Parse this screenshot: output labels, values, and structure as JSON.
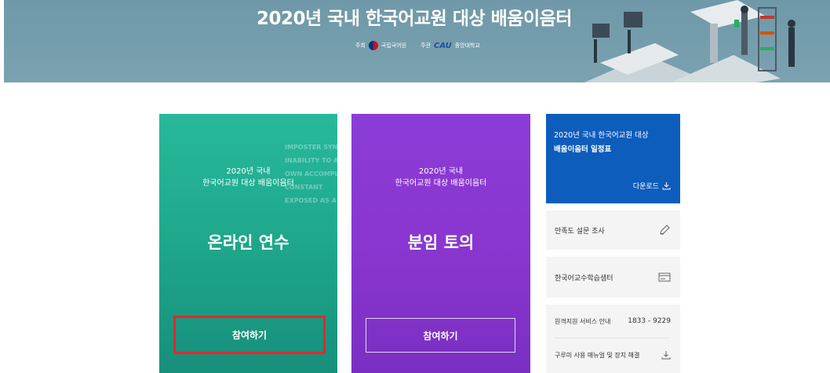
{
  "banner": {
    "title": "2020년 국내 한국어교원 대상 배움이음터",
    "host_label": "주최",
    "host_name": "국립국어원",
    "organizer_label": "주관",
    "organizer_name": "중앙대학교",
    "organizer_logo": "CAU"
  },
  "cards": [
    {
      "subtitle_line1": "2020년 국내",
      "subtitle_line2": "한국어교원 대상 배움이음터",
      "title": "온라인 연수",
      "button": "참여하기"
    },
    {
      "subtitle_line1": "2020년 국내",
      "subtitle_line2": "한국어교원 대상 배움이음터",
      "title": "분임 토의",
      "button": "참여하기"
    }
  ],
  "card_background_text": [
    "IMPOSTER SYN",
    "INABILITY TO A",
    "OWN ACCOMPLI",
    "CONSTANT",
    "EXPOSED AS A"
  ],
  "schedule": {
    "line1": "2020년 국내 한국어교원 대상",
    "line2": "배움이음터 일정표",
    "download": "다운로드"
  },
  "side": {
    "survey": "만족도 설문 조사",
    "center": "한국어교수학습샘터",
    "remote_label": "원격지원 서비스 안내",
    "remote_phone": "1833 - 9229",
    "manual": "구루미 사용 매뉴얼 및 장치 해결"
  },
  "colors": {
    "banner": "#7aa2b1",
    "green_card": "#1fa98d",
    "purple_card": "#8a36d0",
    "schedule_blue": "#0d5dbd",
    "highlight_red": "#e8262a"
  }
}
